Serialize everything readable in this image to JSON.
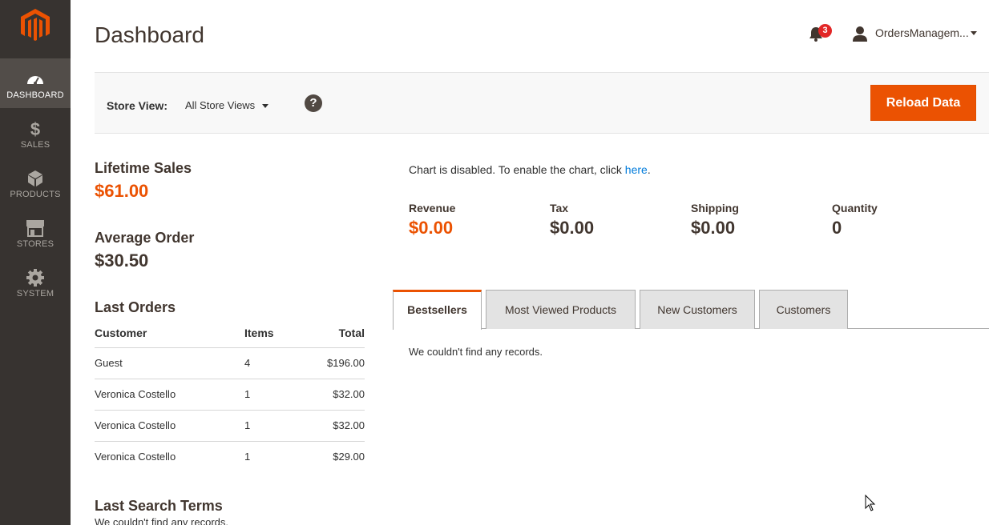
{
  "sidebar": {
    "logo_icon": "magento-logo-icon",
    "items": [
      {
        "label": "DASHBOARD",
        "icon": "gauge-icon",
        "active": true
      },
      {
        "label": "SALES",
        "icon": "dollar-icon",
        "active": false
      },
      {
        "label": "PRODUCTS",
        "icon": "box-icon",
        "active": false
      },
      {
        "label": "STORES",
        "icon": "storefront-icon",
        "active": false
      },
      {
        "label": "SYSTEM",
        "icon": "gear-icon",
        "active": false
      }
    ]
  },
  "header": {
    "title": "Dashboard",
    "notifications_count": "3",
    "user_name": "OrdersManagem..."
  },
  "store_bar": {
    "label": "Store View:",
    "selected": "All Store Views",
    "help": "?",
    "reload_label": "Reload Data"
  },
  "stats": {
    "lifetime_sales_label": "Lifetime Sales",
    "lifetime_sales_value": "$61.00",
    "average_order_label": "Average Order",
    "average_order_value": "$30.50"
  },
  "last_orders": {
    "title": "Last Orders",
    "headers": {
      "customer": "Customer",
      "items": "Items",
      "total": "Total"
    },
    "rows": [
      {
        "customer": "Guest",
        "items": "4",
        "total": "$196.00"
      },
      {
        "customer": "Veronica Costello",
        "items": "1",
        "total": "$32.00"
      },
      {
        "customer": "Veronica Costello",
        "items": "1",
        "total": "$32.00"
      },
      {
        "customer": "Veronica Costello",
        "items": "1",
        "total": "$29.00"
      }
    ]
  },
  "last_search": {
    "title": "Last Search Terms",
    "empty": "We couldn't find any records."
  },
  "chart": {
    "note_prefix": "Chart is disabled. To enable the chart, click ",
    "note_link": "here",
    "note_suffix": "."
  },
  "totals": {
    "revenue_label": "Revenue",
    "revenue_value": "$0.00",
    "tax_label": "Tax",
    "tax_value": "$0.00",
    "shipping_label": "Shipping",
    "shipping_value": "$0.00",
    "quantity_label": "Quantity",
    "quantity_value": "0"
  },
  "tabs": {
    "items": [
      "Bestsellers",
      "Most Viewed Products",
      "New Customers",
      "Customers"
    ],
    "empty": "We couldn't find any records."
  },
  "colors": {
    "accent": "#eb5202",
    "sidebar": "#373330",
    "link": "#007bdb"
  }
}
